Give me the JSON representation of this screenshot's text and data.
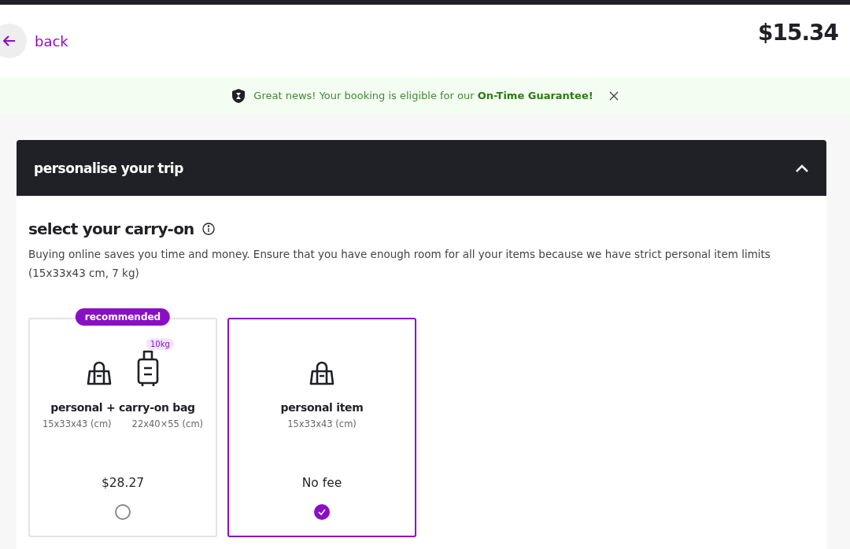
{
  "header": {
    "back_label": "back",
    "price": "$15.34"
  },
  "banner": {
    "text": "Great news! Your booking is eligible for our **On-Time Guarantee!**"
  },
  "panel": {
    "title": "personalise your trip",
    "expanded": true
  },
  "section": {
    "title": "select your carry-on",
    "description": "Buying online saves you time and money. Ensure that you have enough room for all your items because we have strict personal item limits (15x33x43 cm, 7 kg)"
  },
  "options": [
    {
      "badge": "recommended",
      "bags": [
        {
          "kind": "bag"
        },
        {
          "kind": "trolley",
          "tag": "10kg"
        }
      ],
      "title": "personal + carry-on bag",
      "dims": [
        "15x33x43 (cm)",
        "22x40×55 (cm)"
      ],
      "price": "$28.27",
      "selected": false
    },
    {
      "bags": [
        {
          "kind": "bag"
        }
      ],
      "title": "personal item",
      "dims": [
        "15x33x43 (cm)"
      ],
      "price": "No fee",
      "selected": true
    }
  ]
}
